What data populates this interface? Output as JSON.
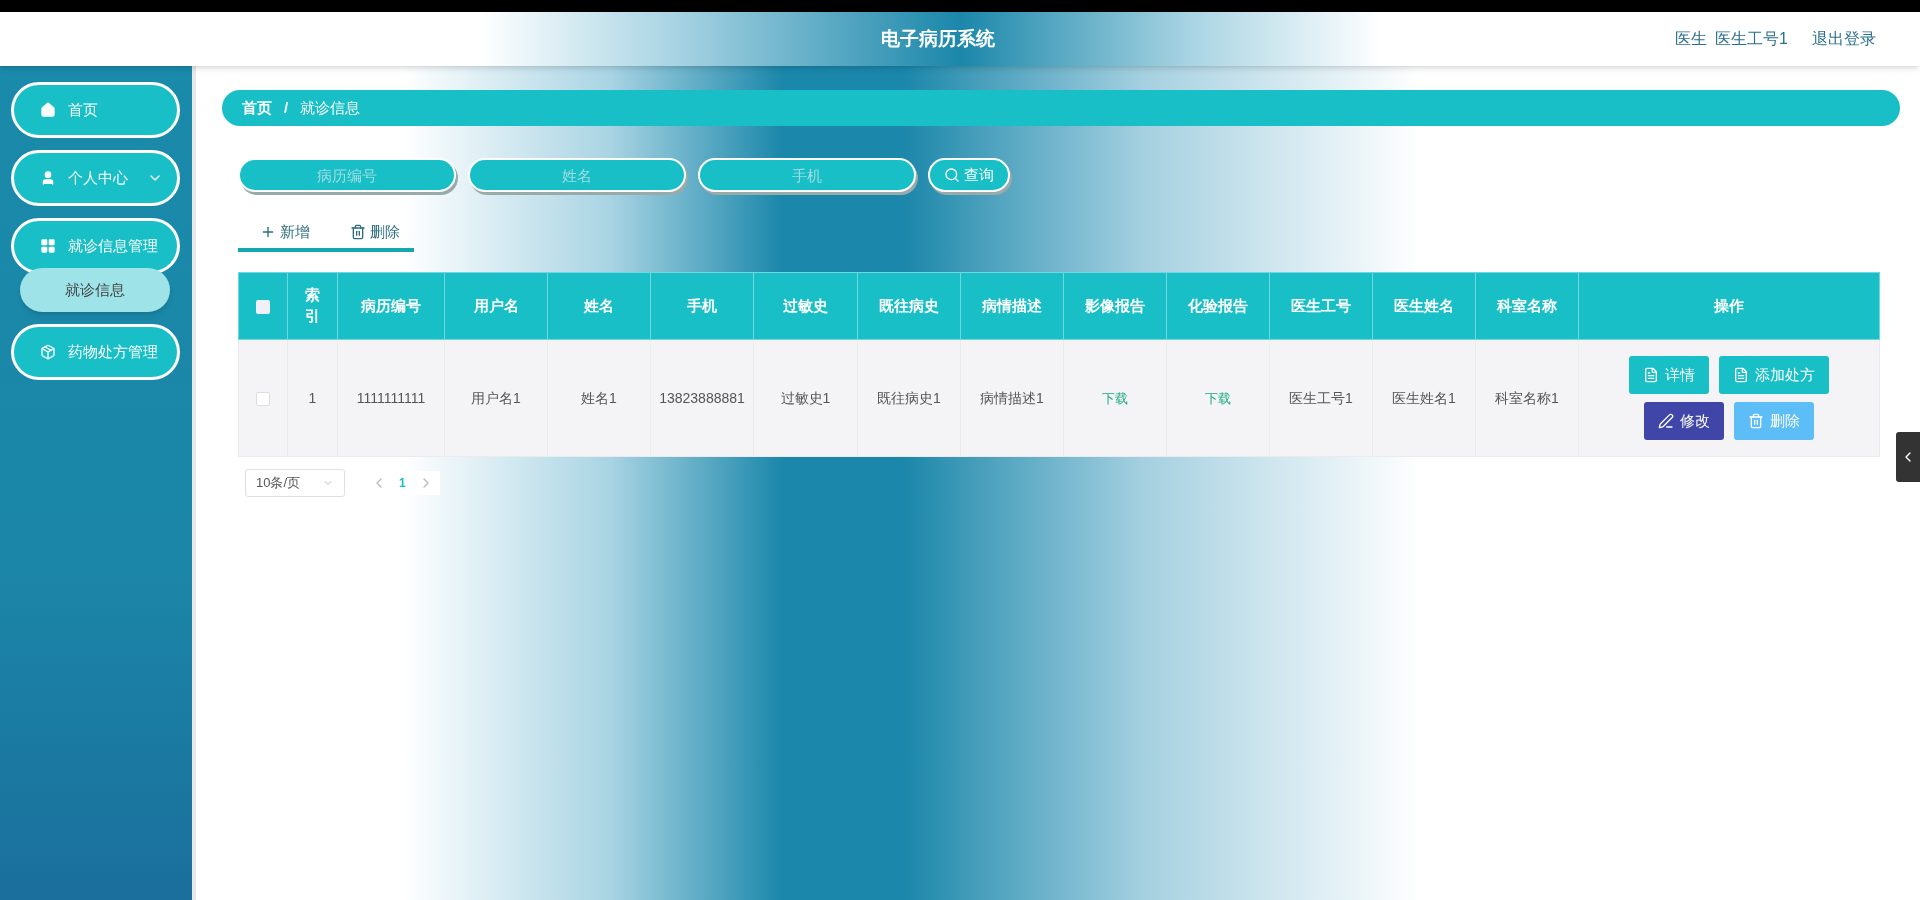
{
  "header": {
    "title": "电子病历系统",
    "role": "医生",
    "user": "医生工号1",
    "logout": "退出登录"
  },
  "sidebar": {
    "items": [
      {
        "kind": "link",
        "label": "首页",
        "selected": false
      },
      {
        "kind": "submenu",
        "label": "个人中心",
        "selected": false
      },
      {
        "kind": "submenu",
        "label": "就诊信息管理",
        "selected": false,
        "children": [
          {
            "label": "就诊信息",
            "selected": true
          }
        ]
      },
      {
        "kind": "submenu",
        "label": "药物处方管理",
        "selected": false
      }
    ]
  },
  "breadcrumb": {
    "home": "首页",
    "separator": "/",
    "current": "就诊信息"
  },
  "search": {
    "fields": [
      {
        "placeholder": "病历编号"
      },
      {
        "placeholder": "姓名"
      },
      {
        "placeholder": "手机"
      }
    ],
    "button": "查询"
  },
  "toolbar": [
    {
      "kind": "add",
      "label": "新增"
    },
    {
      "kind": "delete",
      "label": "删除"
    }
  ],
  "table": {
    "all_checked": false,
    "columns": [
      "索引",
      "病历编号",
      "用户名",
      "姓名",
      "手机",
      "过敏史",
      "既往病史",
      "病情描述",
      "影像报告",
      "化验报告",
      "医生工号",
      "医生姓名",
      "科室名称",
      "操作"
    ],
    "rows": [
      {
        "checked": false,
        "cells": [
          {
            "kind": "text",
            "text": "1"
          },
          {
            "kind": "text",
            "text": "1111111111"
          },
          {
            "kind": "text",
            "text": "用户名1"
          },
          {
            "kind": "text",
            "text": "姓名1"
          },
          {
            "kind": "text",
            "text": "13823888881"
          },
          {
            "kind": "text",
            "text": "过敏史1"
          },
          {
            "kind": "text",
            "text": "既往病史1"
          },
          {
            "kind": "text",
            "text": "病情描述1"
          },
          {
            "kind": "link",
            "text": "下载"
          },
          {
            "kind": "link",
            "text": "下载"
          },
          {
            "kind": "text",
            "text": "医生工号1"
          },
          {
            "kind": "text",
            "text": "医生姓名1"
          },
          {
            "kind": "text",
            "text": "科室名称1"
          }
        ],
        "actions": [
          {
            "kind": "detail",
            "label": "详情"
          },
          {
            "kind": "prescribe",
            "label": "添加处方"
          },
          {
            "kind": "edit",
            "label": "修改"
          },
          {
            "kind": "delete",
            "label": "删除"
          }
        ]
      }
    ]
  },
  "pagination": {
    "page_size": "10条/页",
    "pages": [
      {
        "label": "1",
        "selected": true
      }
    ]
  }
}
